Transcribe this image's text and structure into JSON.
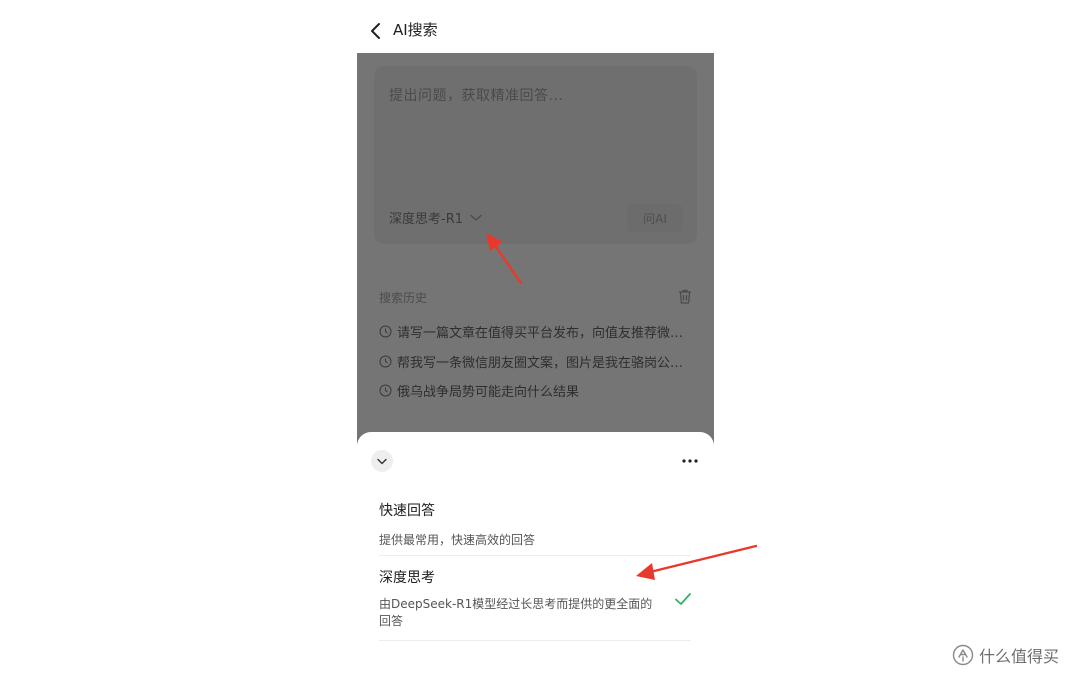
{
  "header": {
    "title": "AI搜索",
    "back_icon": "chevron-left-icon"
  },
  "query": {
    "placeholder": "提出问题，获取精准回答...",
    "model_label": "深度思考-R1",
    "ask_label": "问AI"
  },
  "history": {
    "title": "搜索历史",
    "items": [
      "请写一篇文章在值得买平台发布，向值友推荐微…",
      "帮我写一条微信朋友圈文案，图片是我在骆岗公…",
      "俄乌战争局势可能走向什么结果"
    ]
  },
  "sheet": {
    "options": [
      {
        "title": "快速回答",
        "desc": "提供最常用，快速高效的回答",
        "selected": false
      },
      {
        "title": "深度思考",
        "desc": "由DeepSeek-R1模型经过长思考而提供的更全面的回答",
        "selected": true
      }
    ]
  },
  "watermark": {
    "text": "什么值得买"
  },
  "colors": {
    "overlay": "#757575",
    "annotation_arrow": "#e8392b",
    "check": "#2fb46a"
  }
}
